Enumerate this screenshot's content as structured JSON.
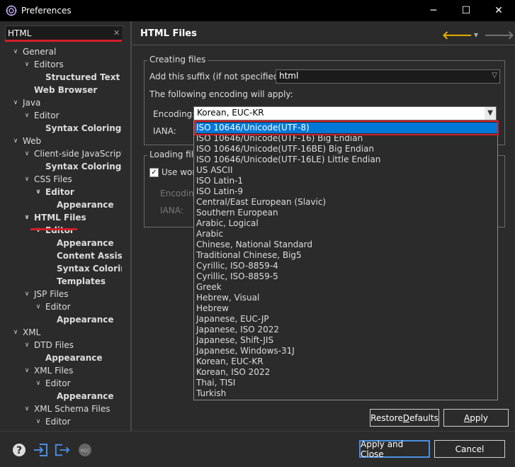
{
  "window": {
    "title": "Preferences",
    "minimize": "─",
    "maximize": "☐",
    "close": "✕"
  },
  "filter": {
    "value": "HTML",
    "clear_icon": "✕"
  },
  "tree": [
    {
      "label": "General",
      "twisty": "∨",
      "indent": 0,
      "bold": false
    },
    {
      "label": "Editors",
      "twisty": "∨",
      "indent": 1,
      "bold": false
    },
    {
      "label": "Structured Text Ed",
      "twisty": "",
      "indent": 2,
      "bold": true
    },
    {
      "label": "Web Browser",
      "twisty": "",
      "indent": 1,
      "bold": true
    },
    {
      "label": "Java",
      "twisty": "∨",
      "indent": 0,
      "bold": false
    },
    {
      "label": "Editor",
      "twisty": "∨",
      "indent": 1,
      "bold": false
    },
    {
      "label": "Syntax Coloring",
      "twisty": "",
      "indent": 2,
      "bold": true
    },
    {
      "label": "Web",
      "twisty": "∨",
      "indent": 0,
      "bold": false
    },
    {
      "label": "Client-side JavaScript",
      "twisty": "∨",
      "indent": 1,
      "bold": false
    },
    {
      "label": "Syntax Coloring",
      "twisty": "",
      "indent": 2,
      "bold": true
    },
    {
      "label": "CSS Files",
      "twisty": "∨",
      "indent": 1,
      "bold": false
    },
    {
      "label": "Editor",
      "twisty": "∨",
      "indent": 2,
      "bold": true
    },
    {
      "label": "Appearance",
      "twisty": "",
      "indent": 3,
      "bold": true
    },
    {
      "label": "HTML Files",
      "twisty": "∨",
      "indent": 1,
      "bold": true
    },
    {
      "label": "Editor",
      "twisty": "∨",
      "indent": 2,
      "bold": true
    },
    {
      "label": "Appearance",
      "twisty": "",
      "indent": 3,
      "bold": true
    },
    {
      "label": "Content Assist",
      "twisty": "",
      "indent": 3,
      "bold": true
    },
    {
      "label": "Syntax Coloring",
      "twisty": "",
      "indent": 3,
      "bold": true
    },
    {
      "label": "Templates",
      "twisty": "",
      "indent": 3,
      "bold": true
    },
    {
      "label": "JSP Files",
      "twisty": "∨",
      "indent": 1,
      "bold": false
    },
    {
      "label": "Editor",
      "twisty": "∨",
      "indent": 2,
      "bold": false
    },
    {
      "label": "Appearance",
      "twisty": "",
      "indent": 3,
      "bold": true
    },
    {
      "label": "XML",
      "twisty": "∨",
      "indent": 0,
      "bold": false
    },
    {
      "label": "DTD Files",
      "twisty": "∨",
      "indent": 1,
      "bold": false
    },
    {
      "label": "Appearance",
      "twisty": "",
      "indent": 2,
      "bold": true
    },
    {
      "label": "XML Files",
      "twisty": "∨",
      "indent": 1,
      "bold": false
    },
    {
      "label": "Editor",
      "twisty": "∨",
      "indent": 2,
      "bold": false
    },
    {
      "label": "Appearance",
      "twisty": "",
      "indent": 3,
      "bold": true
    },
    {
      "label": "XML Schema Files",
      "twisty": "∨",
      "indent": 1,
      "bold": false
    },
    {
      "label": "Editor",
      "twisty": "∨",
      "indent": 2,
      "bold": false
    }
  ],
  "page": {
    "title": "HTML Files",
    "back_icon": "🡐",
    "forward_icon": "🡒",
    "dropdown_icon": "▼",
    "menu_icon": "▼"
  },
  "creating": {
    "legend": "Creating files",
    "suffix_label": "Add this suffix (if not specified):",
    "suffix_value": "html",
    "encoding_note": "The following encoding will apply:",
    "encoding_label": "Encoding:",
    "encoding_value": "Korean, EUC-KR",
    "iana_label": "IANA:"
  },
  "loading": {
    "legend": "Loading file",
    "use_workspace_label": "Use work",
    "encoding_label": "Encoding",
    "iana_label": "IANA:"
  },
  "dropdown": {
    "selected_index": 0,
    "items": [
      "ISO 10646/Unicode(UTF-8)",
      "ISO 10646/Unicode(UTF-16) Big Endian",
      "ISO 10646/Unicode(UTF-16BE) Big Endian",
      "ISO 10646/Unicode(UTF-16LE) Little Endian",
      "US ASCII",
      "ISO Latin-1",
      "ISO Latin-9",
      "Central/East European (Slavic)",
      "Southern European",
      "Arabic, Logical",
      "Arabic",
      "Chinese, National Standard",
      "Traditional Chinese, Big5",
      "Cyrillic, ISO-8859-4",
      "Cyrillic, ISO-8859-5",
      "Greek",
      "Hebrew, Visual",
      "Hebrew",
      "Japanese, EUC-JP",
      "Japanese, ISO 2022",
      "Japanese, Shift-JIS",
      "Japanese, Windows-31J",
      "Korean, EUC-KR",
      "Korean, ISO 2022",
      "Thai, TISI",
      "Turkish"
    ]
  },
  "buttons": {
    "restore_pre": "Restore ",
    "restore_u": "D",
    "restore_post": "efaults",
    "apply_u": "A",
    "apply_post": "pply",
    "apply_close": "Apply and Close",
    "cancel": "Cancel"
  },
  "footer": {
    "help_icon": "?",
    "import_icon": "import-icon",
    "export_icon": "export-icon",
    "record_icon": "REC"
  },
  "colors": {
    "accent_red": "#d11f2a",
    "selection_blue": "#0078d7",
    "nav_back": "#f0b400"
  }
}
